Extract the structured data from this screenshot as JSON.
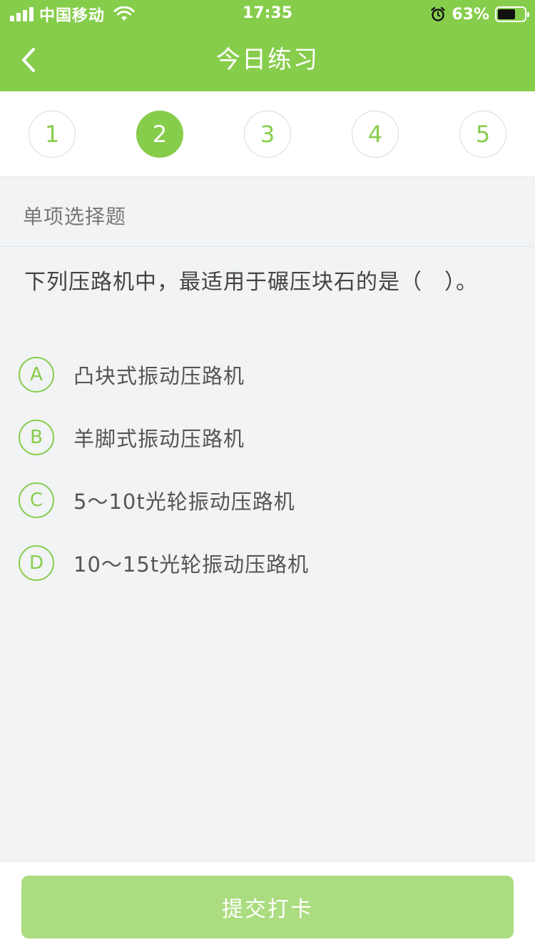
{
  "status_bar": {
    "carrier": "中国移动",
    "time": "17:35",
    "battery": "63%",
    "icons": [
      "signal-icon",
      "wifi-icon",
      "alarm-icon",
      "battery-icon"
    ]
  },
  "nav": {
    "title": "今日练习",
    "back_icon": "chevron-left-icon"
  },
  "question_numbers": {
    "items": [
      "1",
      "2",
      "3",
      "4",
      "5"
    ],
    "active": "2"
  },
  "question": {
    "type": "单项选择题",
    "text": "下列压路机中，最适用于碾压块石的是（　）。",
    "options": [
      {
        "letter": "A",
        "text": "凸块式振动压路机"
      },
      {
        "letter": "B",
        "text": "羊脚式振动压路机"
      },
      {
        "letter": "C",
        "text": "5～10t光轮振动压路机"
      },
      {
        "letter": "D",
        "text": "10～15t光轮振动压路机"
      }
    ]
  },
  "footer": {
    "submit_label": "提交打卡"
  },
  "colors": {
    "accent": "#87cd4c",
    "submit_disabled": "#abdc7f",
    "background": "#f1f3f5",
    "text": "#444444"
  }
}
